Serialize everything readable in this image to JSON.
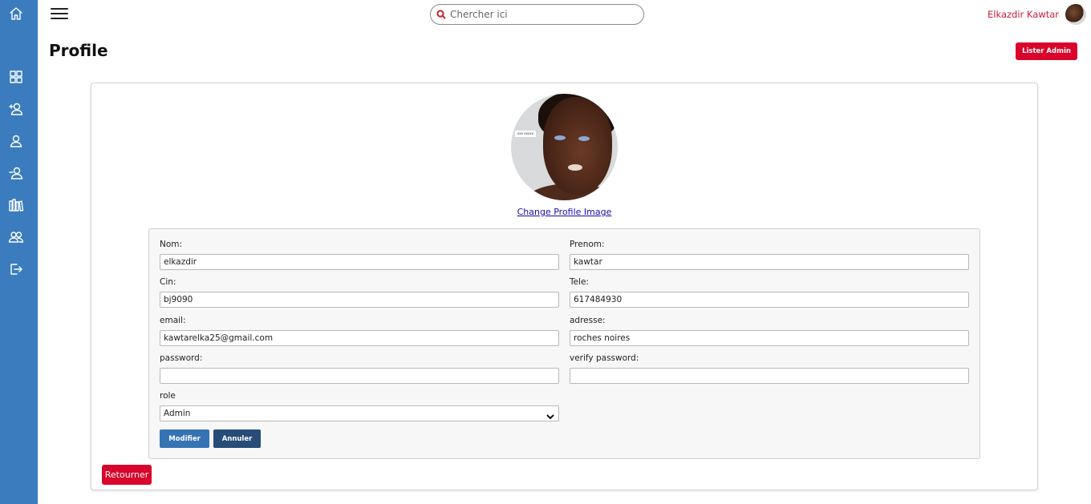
{
  "search": {
    "placeholder": "Chercher ici"
  },
  "user": {
    "name": "Elkazdir Kawtar"
  },
  "page": {
    "title": "Profile"
  },
  "header": {
    "lister_admin_label": "Lister Admin"
  },
  "profile": {
    "change_image_label": "Change Profile Image",
    "image_tag_text": "xxx xxxxx"
  },
  "form": {
    "nom": {
      "label": "Nom:",
      "value": "elkazdir"
    },
    "prenom": {
      "label": "Prenom:",
      "value": "kawtar"
    },
    "cin": {
      "label": "Cin:",
      "value": "bj9090"
    },
    "tele": {
      "label": "Tele:",
      "value": "617484930"
    },
    "email": {
      "label": "email:",
      "value": "kawtarelka25@gmail.com"
    },
    "adresse": {
      "label": "adresse:",
      "value": "roches noires"
    },
    "password": {
      "label": "password:",
      "value": ""
    },
    "verify_password": {
      "label": "verify password:",
      "value": ""
    },
    "role": {
      "label": "role",
      "value": "Admin"
    },
    "modifier_label": "Modifier",
    "annuler_label": "Annuler"
  },
  "retourner_label": "Retourner",
  "colors": {
    "sidebar": "#3a7cbd",
    "accent_red": "#d9042b",
    "modifier_blue": "#3673b4",
    "annuler_navy": "#264c77"
  },
  "sidebar": {
    "icons": [
      "home-icon",
      "dashboard-grid-icon",
      "add-user-icon",
      "user-icon",
      "remove-user-icon",
      "books-icon",
      "users-group-icon",
      "logout-icon"
    ]
  }
}
